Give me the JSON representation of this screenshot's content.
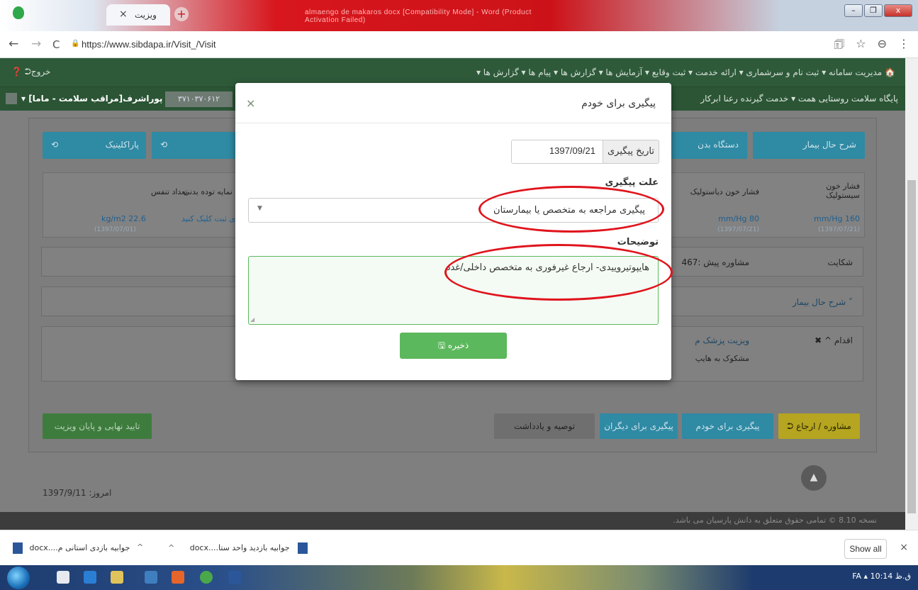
{
  "browser": {
    "tab_title": "ویزیت",
    "tab_close": "×",
    "new_tab": "+",
    "window_title": "almaengo de makaros docx [Compatibility Mode] - Word (Product Activation Failed)",
    "url": "https://www.sibdapa.ir/Visit_/Visit",
    "win_min": "–",
    "win_max": "❐",
    "win_close": "x"
  },
  "topnav": {
    "menu": "🏠  مدیریت سامانه ▾   ثبت نام و سرشماری ▾   ارائه خدمت ▾   ثبت وقایع ▾   آزمایش ها ▾   گزارش ها ▾   پیام ها ▾   گزارش ها ▾",
    "logout": "❓  ⮊خروج"
  },
  "subnav": {
    "facility": "پایگاه سلامت روستایی همت ▾   خدمت گیرنده رعنا ابرکار",
    "code": "۳۷۱۰۳۷۰۶۱۲",
    "role": "راشین پوراشرف[مراقب سلامت - ماما] ▾"
  },
  "background": {
    "paraclinic": "پاراکلینیک",
    "body_system": "دستگاه بدن",
    "history": "شرح حال بیمار",
    "bmi_label": "نمایه توده بدنی",
    "bmi_value": "kg/m2 22.6",
    "bmi_date": "(1397/07/01)",
    "resp_label": "تعداد تنفس",
    "resp_value": "برای ثبت کلیک کنید",
    "dia_label": "فشار خون دیاستولیک",
    "dia_value": "mm/Hg 80",
    "dia_date": "(1397/07/21)",
    "sys_label": "فشار خون سیستولیک",
    "sys_value": "mm/Hg 160",
    "sys_date": "(1397/07/21)",
    "complaint": "شکایت",
    "complaint_value": "467: مشاوره پیش",
    "history_toggle": "شرح حال بیمار ˅",
    "action": "✖ ^ اقدام",
    "doctor_visit": "ویزیت پزشک م",
    "suspect": "مشکوک به هایپ",
    "finish": "تایید نهایی و پایان ویزیت",
    "notes": "توصیه و یادداشت",
    "followup_others": "پیگیری برای دیگران",
    "followup_self": "پیگیری برای خودم",
    "consult": "⮊ مشاوره / ارجاع",
    "today": "امروز: 1397/9/11",
    "copyright": "نسخه 8.10  © تمامی حقوق متعلق به دانش پارسیان می باشد."
  },
  "modal": {
    "title": "پیگیری برای خودم",
    "close": "×",
    "date_label": "تاریخ پیگیری",
    "date_value": "1397/09/21",
    "reason_label": "علت پیگیری",
    "reason_value": "پیگیری مراجعه به متخصص یا بیمارستان",
    "desc_label": "توضیحات",
    "desc_value": "هایپوتیروییدی- ارجاع غیرفوری به متخصص داخلی/غدد",
    "save_label": "🖫 ذخیره"
  },
  "downloads": {
    "item1": "docx....جوابیه بازدید واحد ستا",
    "item2": "docx....جوابیه بازدی استانی م",
    "show_all": "Show all",
    "close": "×"
  },
  "taskbar": {
    "tray": "FA  ▴   10:14 ق.ظ"
  },
  "colors": {
    "annotation": "#e0141c",
    "save": "#5cb85c",
    "teal": "#2f8aa4"
  }
}
